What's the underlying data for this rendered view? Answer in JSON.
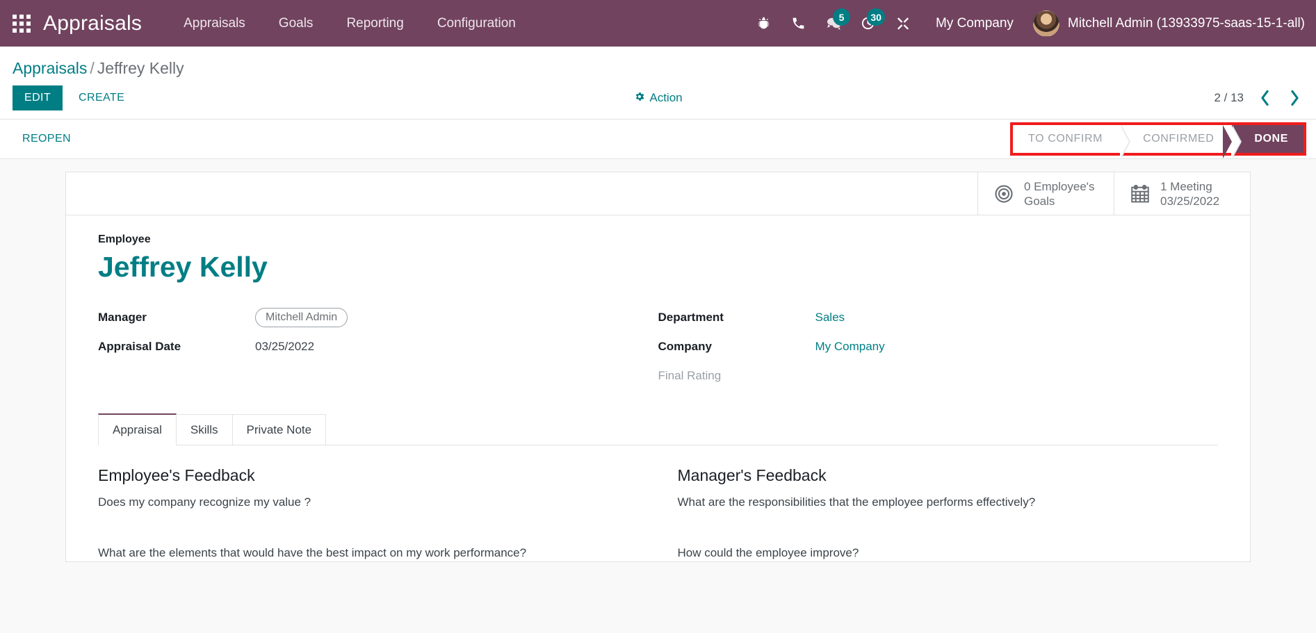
{
  "navbar": {
    "apps_icon": "apps-grid-icon",
    "brand": "Appraisals",
    "menu_items": [
      {
        "label": "Appraisals"
      },
      {
        "label": "Goals"
      },
      {
        "label": "Reporting"
      },
      {
        "label": "Configuration"
      }
    ],
    "icons": [
      {
        "name": "bug-icon",
        "badge": null
      },
      {
        "name": "phone-icon",
        "badge": null
      },
      {
        "name": "messages-icon",
        "badge": "5"
      },
      {
        "name": "activities-clock-icon",
        "badge": "30"
      },
      {
        "name": "developer-tools-icon",
        "badge": null
      }
    ],
    "company": "My Company",
    "user": "Mitchell Admin (13933975-saas-15-1-all)",
    "colors": {
      "bar": "#71435f",
      "badge": "#017e84"
    }
  },
  "breadcrumb": {
    "root": "Appraisals",
    "separator": "/",
    "current": "Jeffrey Kelly"
  },
  "controls": {
    "edit_label": "EDIT",
    "create_label": "CREATE",
    "action_label": "Action",
    "action_icon": "gear-icon",
    "pager_value": "2 / 13",
    "pager_prev_icon": "chevron-left-icon",
    "pager_next_icon": "chevron-right-icon"
  },
  "statusbar": {
    "reopen_label": "REOPEN",
    "stages": [
      {
        "label": "TO CONFIRM",
        "active": false
      },
      {
        "label": "CONFIRMED",
        "active": false
      },
      {
        "label": "DONE",
        "active": true
      }
    ],
    "highlight_color": "#f01c1c",
    "active_color": "#71435f"
  },
  "smart_buttons": [
    {
      "icon": "target-goals-icon",
      "line1": "0 Employee's",
      "line2": "Goals"
    },
    {
      "icon": "calendar-icon",
      "line1": "1 Meeting",
      "line2": "03/25/2022"
    }
  ],
  "form": {
    "employee_label": "Employee",
    "employee_name": "Jeffrey Kelly",
    "left_fields": [
      {
        "label": "Manager",
        "value": "Mitchell Admin",
        "type": "tag"
      },
      {
        "label": "Appraisal Date",
        "value": "03/25/2022",
        "type": "text"
      }
    ],
    "right_fields": [
      {
        "label": "Department",
        "value": "Sales",
        "type": "link"
      },
      {
        "label": "Company",
        "value": "My Company",
        "type": "link"
      },
      {
        "label": "Final Rating",
        "value": "",
        "type": "empty"
      }
    ]
  },
  "notebook": {
    "tabs": [
      {
        "label": "Appraisal",
        "active": true
      },
      {
        "label": "Skills",
        "active": false
      },
      {
        "label": "Private Note",
        "active": false
      }
    ],
    "employee_feedback": {
      "title": "Employee's Feedback",
      "q1": "Does my company recognize my value ?",
      "q2": "What are the elements that would have the best impact on my work performance?"
    },
    "manager_feedback": {
      "title": "Manager's Feedback",
      "q1": "What are the responsibilities that the employee performs effectively?",
      "q2": "How could the employee improve?"
    }
  }
}
